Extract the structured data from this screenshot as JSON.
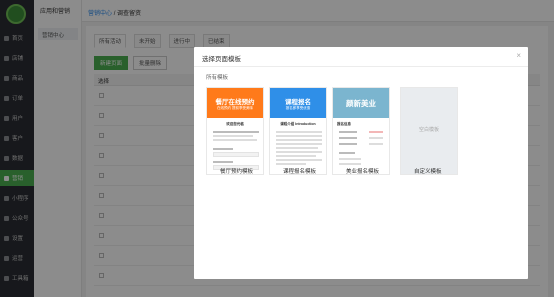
{
  "sidebar": {
    "items": [
      {
        "label": "首页",
        "icon": "home-icon"
      },
      {
        "label": "店铺",
        "icon": "store-icon"
      },
      {
        "label": "商品",
        "icon": "goods-icon"
      },
      {
        "label": "订单",
        "icon": "order-icon"
      },
      {
        "label": "用户",
        "icon": "user-icon"
      },
      {
        "label": "客户",
        "icon": "customer-icon"
      },
      {
        "label": "数据",
        "icon": "data-icon"
      },
      {
        "label": "营销",
        "icon": "marketing-icon",
        "active": true
      },
      {
        "label": "小程序",
        "icon": "miniprogram-icon"
      },
      {
        "label": "公众号",
        "icon": "wechat-icon"
      },
      {
        "label": "设置",
        "icon": "settings-icon"
      },
      {
        "label": "运营",
        "icon": "operation-icon"
      },
      {
        "label": "工具箱",
        "icon": "toolbox-icon"
      }
    ]
  },
  "subbar": {
    "title": "应用和营销",
    "item": "营销中心"
  },
  "header": {
    "crumb_link": "营销中心",
    "crumb_sep": "/",
    "crumb_current": "调查留资"
  },
  "main": {
    "tabs": [
      "所有活动",
      "未开始",
      "进行中",
      "已结束"
    ],
    "buttons": {
      "create": "新建页面",
      "batch_delete": "批量删除"
    },
    "table_head": "选择",
    "rows": [
      {
        "link": "",
        "time": ""
      },
      {
        "link": "",
        "time": ""
      },
      {
        "link": "",
        "time": ""
      },
      {
        "link": "",
        "time": ""
      },
      {
        "link": "",
        "time": ""
      },
      {
        "link": "",
        "time": ""
      },
      {
        "link": "",
        "time": ""
      },
      {
        "link": "",
        "time": ""
      },
      {
        "link": "",
        "time": ""
      },
      {
        "link": "",
        "time": ""
      }
    ]
  },
  "modal": {
    "title": "选择页面模板",
    "close": "×",
    "section": "所有模板",
    "templates": [
      {
        "caption": "餐厅预约模板",
        "banner": "餐厅在线预约",
        "banner_sub": "在线预约 提前享受美味",
        "color": "#ff7a1a",
        "heading": "欢迎您光临"
      },
      {
        "caption": "课程报名模板",
        "banner": "课程报名",
        "banner_sub": "报名即享受优惠",
        "color": "#2f8fe8",
        "heading": "课程介绍 Introduction"
      },
      {
        "caption": "美业报名模板",
        "banner": "颜新美业",
        "banner_sub": "",
        "color": "#7bb5cf",
        "heading": "报名信息"
      },
      {
        "caption": "自定义模板",
        "banner": "",
        "banner_sub": "",
        "color": "#e9ecef",
        "heading": "空白模板"
      }
    ]
  }
}
